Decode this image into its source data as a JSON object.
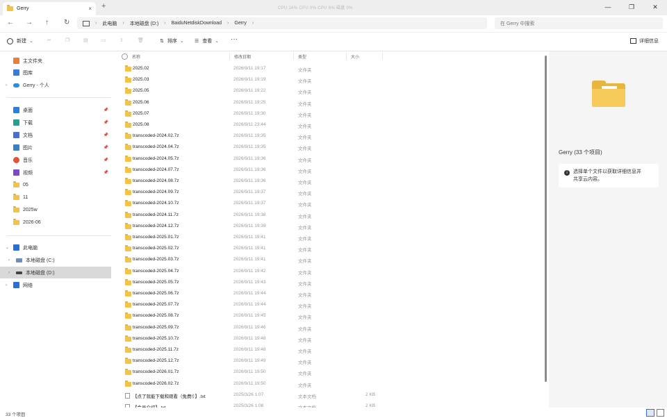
{
  "window": {
    "tab_title": "Gerry",
    "tab_close": "×",
    "new_tab": "+",
    "sys_info": "CPU 16%   CPU 0%   CPU 6%   磁盘 0%",
    "controls": [
      "—",
      "❐",
      "✕"
    ]
  },
  "address": {
    "back": "←",
    "forward": "→",
    "up": "↑",
    "refresh": "↻",
    "crumbs": [
      "此电脑",
      "›",
      "本地磁盘 (D:)",
      "›",
      "BaiduNetdiskDownload",
      "›",
      "Gerry",
      "›"
    ],
    "search_placeholder": "在 Gerry 中搜索"
  },
  "toolbar": {
    "new_label": "新建",
    "sort_label": "排序",
    "view_label": "查看",
    "more_label": "···",
    "details_label": "详细信息"
  },
  "sidebar": {
    "quick": [
      {
        "label": "主文件夹",
        "color": "#e8803a"
      },
      {
        "label": "图库",
        "color": "#3a7bd5"
      },
      {
        "label": "Gerry - 个人",
        "color": "#2b8fe0"
      }
    ],
    "pinned": [
      {
        "label": "桌面",
        "color": "#2f7fd6"
      },
      {
        "label": "下载",
        "color": "#2a9d8f"
      },
      {
        "label": "文档",
        "color": "#4a6fd1"
      },
      {
        "label": "图片",
        "color": "#3b82c4"
      },
      {
        "label": "音乐",
        "color": "#e0533d"
      },
      {
        "label": "视频",
        "color": "#7b4bc4"
      }
    ],
    "folders": [
      "05",
      "11",
      "2025w",
      "2026-06"
    ],
    "drives": [
      {
        "label": "此电脑",
        "color": "#2b6fd6"
      },
      {
        "label": "本地磁盘 (C:)",
        "color": "#6b8fb8"
      },
      {
        "label": "本地磁盘 (D:)",
        "color": "#444444"
      },
      {
        "label": "网络",
        "color": "#2b6fd6"
      }
    ]
  },
  "columns": {
    "name": "名称",
    "date": "修改日期",
    "type": "类型",
    "size": "大小"
  },
  "files": [
    {
      "name": "2025.02",
      "date": "2026/9/11 19:17",
      "type": "文件夹",
      "size": "",
      "kind": "folder"
    },
    {
      "name": "2025.03",
      "date": "2026/9/11 19:19",
      "type": "文件夹",
      "size": "",
      "kind": "folder"
    },
    {
      "name": "2025.05",
      "date": "2026/9/11 19:22",
      "type": "文件夹",
      "size": "",
      "kind": "folder"
    },
    {
      "name": "2025.06",
      "date": "2026/9/11 19:25",
      "type": "文件夹",
      "size": "",
      "kind": "folder"
    },
    {
      "name": "2025.07",
      "date": "2026/9/11 19:30",
      "type": "文件夹",
      "size": "",
      "kind": "folder"
    },
    {
      "name": "2025.08",
      "date": "2026/9/11 23:44",
      "type": "文件夹",
      "size": "",
      "kind": "folder"
    },
    {
      "name": "transcoded-2024.02.7z",
      "date": "2026/9/11 19:35",
      "type": "文件夹",
      "size": "",
      "kind": "folder"
    },
    {
      "name": "transcoded-2024.04.7z",
      "date": "2026/9/11 19:35",
      "type": "文件夹",
      "size": "",
      "kind": "folder"
    },
    {
      "name": "transcoded-2024.05.7z",
      "date": "2026/9/11 19:36",
      "type": "文件夹",
      "size": "",
      "kind": "folder"
    },
    {
      "name": "transcoded-2024.07.7z",
      "date": "2026/9/11 19:36",
      "type": "文件夹",
      "size": "",
      "kind": "folder"
    },
    {
      "name": "transcoded-2024.08.7z",
      "date": "2026/9/11 19:36",
      "type": "文件夹",
      "size": "",
      "kind": "folder"
    },
    {
      "name": "transcoded-2024.09.7z",
      "date": "2026/9/11 19:37",
      "type": "文件夹",
      "size": "",
      "kind": "folder"
    },
    {
      "name": "transcoded-2024.10.7z",
      "date": "2026/9/11 19:37",
      "type": "文件夹",
      "size": "",
      "kind": "folder"
    },
    {
      "name": "transcoded-2024.11.7z",
      "date": "2026/9/11 19:38",
      "type": "文件夹",
      "size": "",
      "kind": "folder"
    },
    {
      "name": "transcoded-2024.12.7z",
      "date": "2026/9/11 19:39",
      "type": "文件夹",
      "size": "",
      "kind": "folder"
    },
    {
      "name": "transcoded-2025.01.7z",
      "date": "2026/9/11 19:41",
      "type": "文件夹",
      "size": "",
      "kind": "folder"
    },
    {
      "name": "transcoded-2025.02.7z",
      "date": "2026/9/11 19:41",
      "type": "文件夹",
      "size": "",
      "kind": "folder"
    },
    {
      "name": "transcoded-2025.03.7z",
      "date": "2026/9/11 19:41",
      "type": "文件夹",
      "size": "",
      "kind": "folder"
    },
    {
      "name": "transcoded-2025.04.7z",
      "date": "2026/9/11 19:42",
      "type": "文件夹",
      "size": "",
      "kind": "folder"
    },
    {
      "name": "transcoded-2025.05.7z",
      "date": "2026/9/11 19:43",
      "type": "文件夹",
      "size": "",
      "kind": "folder"
    },
    {
      "name": "transcoded-2025.06.7z",
      "date": "2026/9/11 19:44",
      "type": "文件夹",
      "size": "",
      "kind": "folder"
    },
    {
      "name": "transcoded-2025.07.7z",
      "date": "2026/9/11 19:44",
      "type": "文件夹",
      "size": "",
      "kind": "folder"
    },
    {
      "name": "transcoded-2025.08.7z",
      "date": "2026/9/11 19:45",
      "type": "文件夹",
      "size": "",
      "kind": "folder"
    },
    {
      "name": "transcoded-2025.09.7z",
      "date": "2026/9/11 19:46",
      "type": "文件夹",
      "size": "",
      "kind": "folder"
    },
    {
      "name": "transcoded-2025.10.7z",
      "date": "2026/9/11 19:48",
      "type": "文件夹",
      "size": "",
      "kind": "folder"
    },
    {
      "name": "transcoded-2025.11.7z",
      "date": "2026/9/11 19:48",
      "type": "文件夹",
      "size": "",
      "kind": "folder"
    },
    {
      "name": "transcoded-2025.12.7z",
      "date": "2026/9/11 19:49",
      "type": "文件夹",
      "size": "",
      "kind": "folder"
    },
    {
      "name": "transcoded-2026.01.7z",
      "date": "2026/9/11 19:50",
      "type": "文件夹",
      "size": "",
      "kind": "folder"
    },
    {
      "name": "transcoded-2026.02.7z",
      "date": "2026/9/11 19:50",
      "type": "文件夹",
      "size": "",
      "kind": "folder"
    },
    {
      "name": "【点了就能下载和观看（免费!）】.txt",
      "date": "2025/3/26 1:07",
      "type": "文本文档",
      "size": "2 KB",
      "kind": "txt"
    },
    {
      "name": "【会员介绍】.txt",
      "date": "2025/3/26 1:08",
      "type": "文本文档",
      "size": "2 KB",
      "kind": "txt"
    }
  ],
  "preview": {
    "title": "Gerry (33 个项目)",
    "info_icon": "i",
    "info_text_1": "选择单个文件以获取详细信息并",
    "info_text_2": "共享云内容。"
  },
  "status": {
    "count": "33 个项目"
  }
}
